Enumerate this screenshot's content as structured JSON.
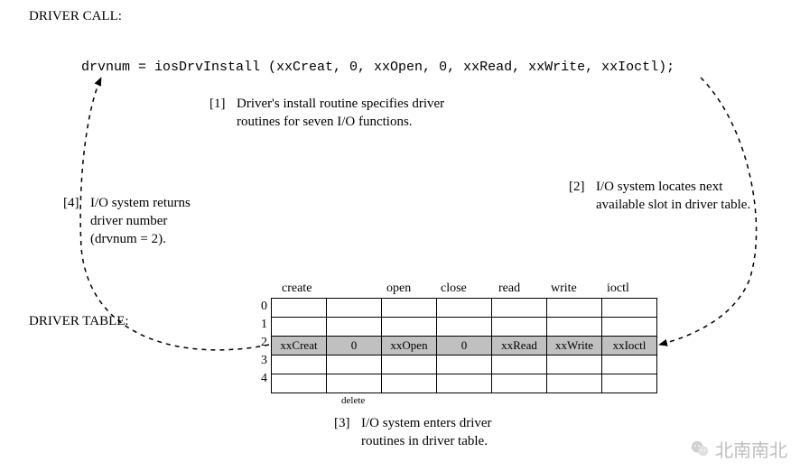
{
  "titles": {
    "driver_call": "DRIVER CALL:",
    "driver_table": "DRIVER TABLE:"
  },
  "code_line": "drvnum = iosDrvInstall (xxCreat, 0, xxOpen, 0, xxRead, xxWrite, xxIoctl);",
  "notes": {
    "n1_tag": "[1]",
    "n1_line1": "Driver's install routine specifies driver",
    "n1_line2": "routines for seven I/O functions.",
    "n2_tag": "[2]",
    "n2_line1": "I/O system locates next",
    "n2_line2": "available slot in driver table.",
    "n3_tag": "[3]",
    "n3_line1": "I/O system enters driver",
    "n3_line2": "routines in driver table.",
    "n4_tag": "[4]",
    "n4_line1": "I/O system returns",
    "n4_line2": "driver number",
    "n4_line3": "(drvnum = 2)."
  },
  "table": {
    "headers": [
      "create",
      "",
      "open",
      "close",
      "read",
      "write",
      "ioctl"
    ],
    "rows": [
      "0",
      "1",
      "2",
      "3",
      "4"
    ],
    "filled_row": {
      "index": "2",
      "cells": [
        "xxCreat",
        "0",
        "xxOpen",
        "0",
        "xxRead",
        "xxWrite",
        "xxIoctl"
      ]
    },
    "delete_label": "delete"
  },
  "watermark": "北南南北"
}
